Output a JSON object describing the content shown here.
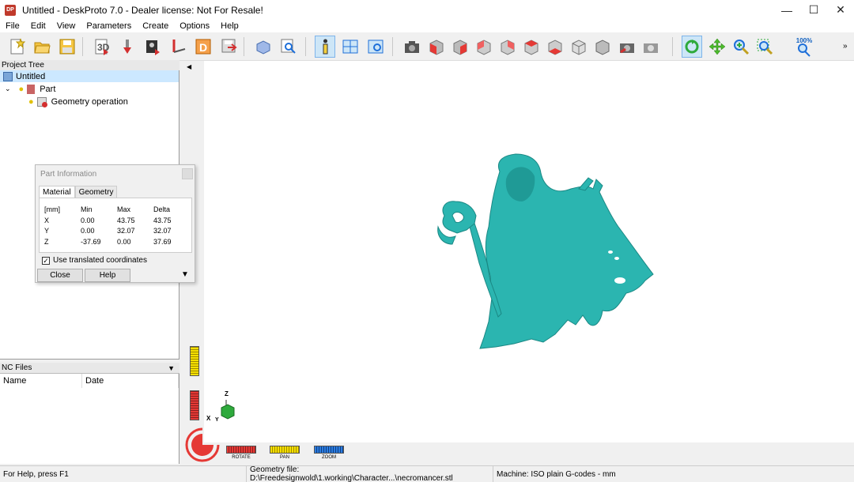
{
  "window": {
    "title": "Untitled - DeskProto 7.0 - Dealer license: Not For Resale!",
    "logo": "DP",
    "controls": [
      "minimize-icon",
      "maximize-icon",
      "close-icon"
    ]
  },
  "menu": [
    "File",
    "Edit",
    "View",
    "Parameters",
    "Create",
    "Options",
    "Help"
  ],
  "toolbar": {
    "zoom_label": "100%",
    "icons": [
      "new-icon",
      "open-icon",
      "save-icon",
      "import-icon",
      "tool-icon",
      "bitmap-icon",
      "vector-icon",
      "dxf-icon",
      "export-icon",
      "part-icon",
      "search-icon",
      "info-icon",
      "view-split-icon",
      "properties-icon",
      "camera-icon",
      "cube-front-icon",
      "cube-back-icon",
      "cube-left-icon",
      "cube-right-icon",
      "cube-top-icon",
      "cube-bottom-icon",
      "cube-iso-icon",
      "cube-iso-alt-icon",
      "camera-store-icon",
      "camera-restore-icon",
      "rotate-icon",
      "pan-icon",
      "zoom-icon",
      "zoom-window-icon",
      "zoom-fit-icon"
    ]
  },
  "project_tree": {
    "header": "Project Tree",
    "items": [
      {
        "label": "Untitled"
      },
      {
        "label": "Part"
      },
      {
        "label": "Geometry operation"
      }
    ]
  },
  "nc_files": {
    "header": "NC Files",
    "columns": [
      "Name",
      "Date"
    ]
  },
  "part_info": {
    "title": "Part Information",
    "tabs": [
      "Material",
      "Geometry"
    ],
    "headers": [
      "[mm]",
      "Min",
      "Max",
      "Delta"
    ],
    "rows": [
      [
        "X",
        "0.00",
        "43.75",
        "43.75"
      ],
      [
        "Y",
        "0.00",
        "32.07",
        "32.07"
      ],
      [
        "Z",
        "-37.69",
        "0.00",
        "37.69"
      ]
    ],
    "checkbox_label": "Use translated coordinates",
    "checkbox_checked": true,
    "close_label": "Close",
    "help_label": "Help"
  },
  "viewport": {
    "model_color": "#2bb5b0",
    "axes": {
      "x": "X",
      "y": "Y",
      "z": "Z"
    },
    "controls": {
      "rotate": "ROTATE",
      "pan": "PAN",
      "zoom": "ZOOM"
    }
  },
  "status": {
    "help": "For Help, press F1",
    "geometry": "Geometry file: D:\\Freedesignwold\\1.working\\Character...\\necromancer.stl",
    "machine": "Machine: ISO plain G-codes - mm"
  }
}
